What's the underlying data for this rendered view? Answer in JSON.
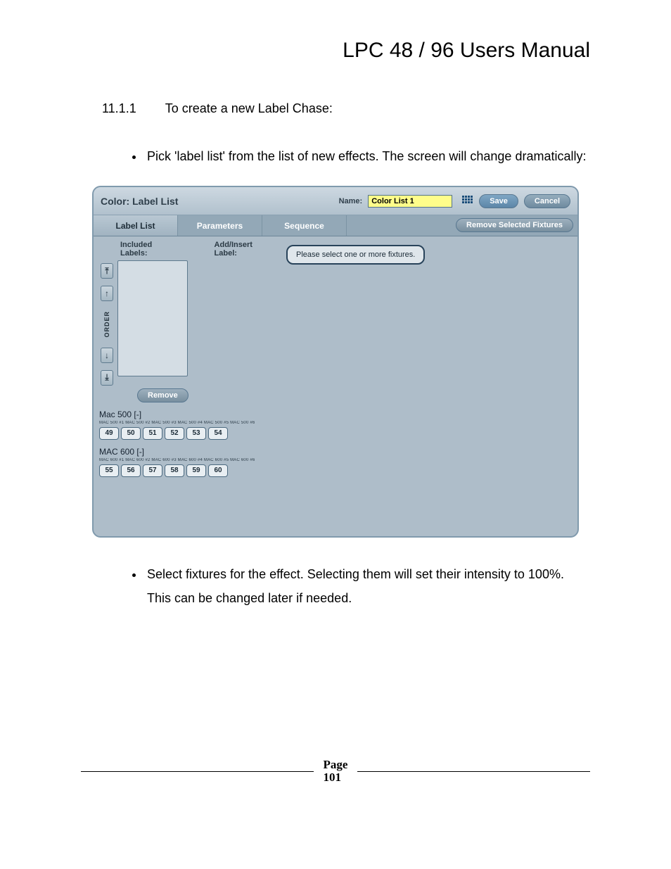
{
  "doc": {
    "title": "LPC 48 / 96 Users Manual",
    "section_number": "11.1.1",
    "section_title": "To create a new Label Chase:",
    "bullet1": "Pick 'label list' from the list of new effects. The screen will change dramatically:",
    "bullet2": "Select fixtures for the effect.  Selecting them will set their intensity to 100%. This can be changed later if needed.",
    "page_label": "Page",
    "page_number": "101"
  },
  "app": {
    "title": "Color: Label List",
    "name_label": "Name:",
    "name_value": "Color List 1",
    "save": "Save",
    "cancel": "Cancel",
    "tabs": {
      "t1": "Label List",
      "t2": "Parameters",
      "t3": "Sequence"
    },
    "remove_fixtures": "Remove Selected Fixtures",
    "col_included": "Included Labels:",
    "col_addinsert": "Add/Insert Label:",
    "order_label": "ORDER",
    "remove": "Remove",
    "tooltip": "Please select one or more fixtures.",
    "groups": [
      {
        "title": "Mac 500 [-]",
        "sub": "MAC 500 #1 MAC 500 #2 MAC 500 #3 MAC 500 #4 MAC 500 #5 MAC 500 #6",
        "items": [
          "49",
          "50",
          "51",
          "52",
          "53",
          "54"
        ]
      },
      {
        "title": "MAC 600 [-]",
        "sub": "MAC 600 #1 MAC 600 #2 MAC 600 #3 MAC 600 #4 MAC 600 #5 MAC 600 #6",
        "items": [
          "55",
          "56",
          "57",
          "58",
          "59",
          "60"
        ]
      }
    ]
  }
}
